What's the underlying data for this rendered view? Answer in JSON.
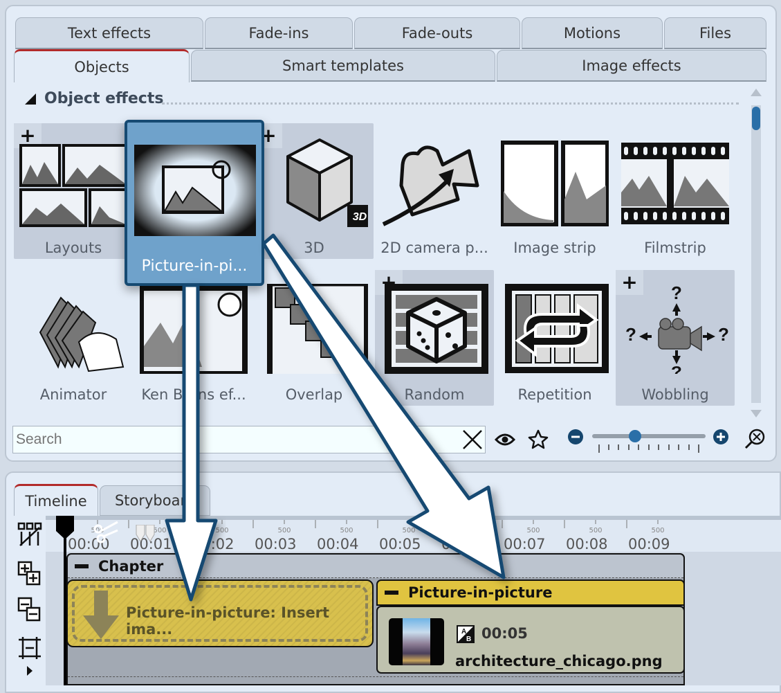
{
  "effects_panel": {
    "tabs_row1": [
      "Text effects",
      "Fade-ins",
      "Fade-outs",
      "Motions",
      "Files"
    ],
    "tabs_row2": [
      "Objects",
      "Smart templates",
      "Image effects"
    ],
    "active_tab": "Objects",
    "section_title": "Object effects",
    "tiles": [
      {
        "label": "Layouts",
        "icon": "layouts-icon",
        "has_plus": true,
        "highlighted": true
      },
      {
        "label": "Picture-in-pi...",
        "icon": "picture-in-picture-icon",
        "has_plus": false,
        "selected": true
      },
      {
        "label": "3D",
        "icon": "3d-cube-icon",
        "has_plus": true,
        "highlighted": true
      },
      {
        "label": "2D camera p...",
        "icon": "2d-camera-pan-icon",
        "has_plus": false
      },
      {
        "label": "Image strip",
        "icon": "image-strip-icon",
        "has_plus": false
      },
      {
        "label": "Filmstrip",
        "icon": "filmstrip-icon",
        "has_plus": false
      },
      {
        "label": "Animator",
        "icon": "animator-icon",
        "has_plus": false
      },
      {
        "label": "Ken Burns ef...",
        "icon": "ken-burns-icon",
        "has_plus": false
      },
      {
        "label": "Overlap",
        "icon": "overlap-icon",
        "has_plus": false
      },
      {
        "label": "Random",
        "icon": "random-dice-icon",
        "has_plus": true,
        "highlighted": true
      },
      {
        "label": "Repetition",
        "icon": "repetition-icon",
        "has_plus": false
      },
      {
        "label": "Wobbling",
        "icon": "wobbling-camera-icon",
        "has_plus": true,
        "highlighted": true
      }
    ],
    "plus_symbol": "+",
    "badge_3d": "3D",
    "search": {
      "placeholder": "Search",
      "value": ""
    },
    "zoom_slider": {
      "value_fraction": 0.38
    }
  },
  "timeline_panel": {
    "tabs": [
      "Timeline",
      "Storyboard"
    ],
    "active_tab": "Timeline",
    "ruler": {
      "labels": [
        "00:00",
        "00:01",
        "00:02",
        "00:03",
        "00:04",
        "00:05",
        "00:06",
        "00:07",
        "00:08",
        "00:09"
      ],
      "sub_label": "500"
    },
    "chapter": {
      "title": "Chapter"
    },
    "placeholder": {
      "text": "Picture-in-picture: Insert ima..."
    },
    "pip_group": {
      "title": "Picture-in-picture"
    },
    "clip": {
      "duration": "00:05",
      "filename": "architecture_chicago.png"
    }
  },
  "colors": {
    "accent_blue": "#2a6fa8",
    "selected_tile": "#6fa2cb",
    "active_tab_marker": "#b22a2a",
    "pip_yellow": "#e0c440",
    "arrow_outline": "#164a72"
  }
}
